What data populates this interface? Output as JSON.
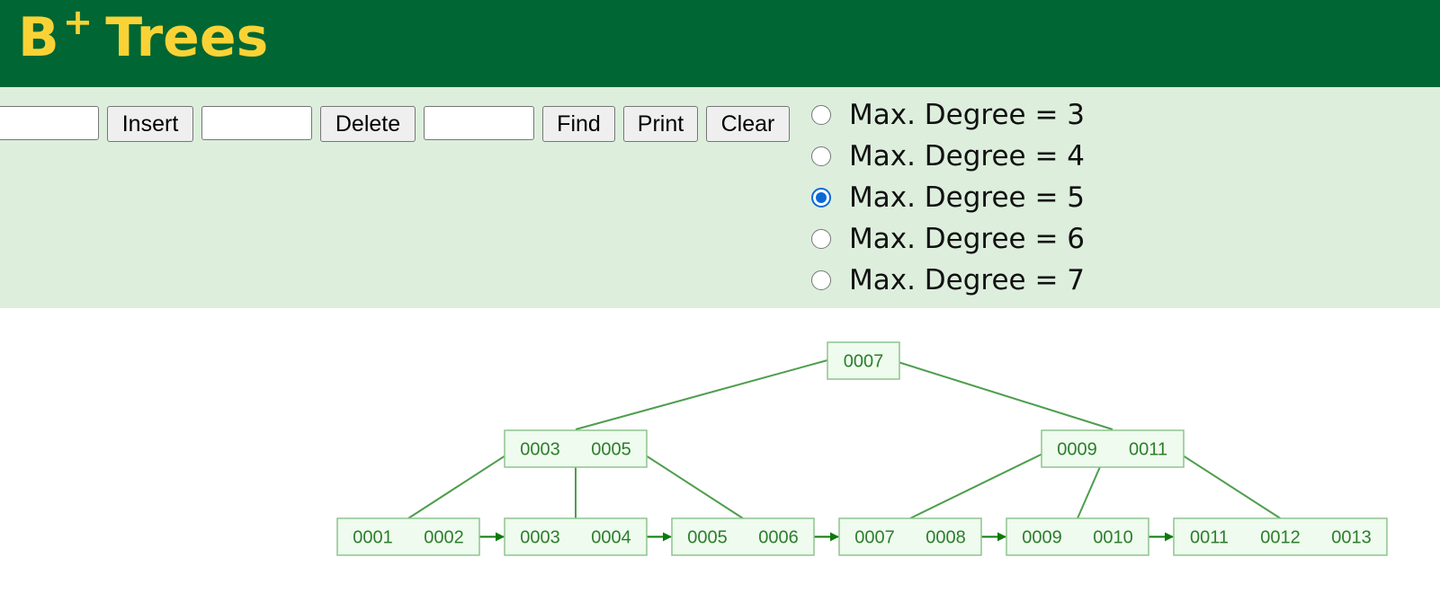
{
  "header": {
    "title_main": "B",
    "title_sup": "+",
    "title_rest": "Trees"
  },
  "controls": {
    "insert_value": "",
    "insert_label": "Insert",
    "delete_value": "",
    "delete_label": "Delete",
    "find_value": "",
    "find_label": "Find",
    "print_label": "Print",
    "clear_label": "Clear"
  },
  "degree_options": [
    {
      "label": "Max. Degree = 3",
      "checked": false
    },
    {
      "label": "Max. Degree = 4",
      "checked": false
    },
    {
      "label": "Max. Degree = 5",
      "checked": true
    },
    {
      "label": "Max. Degree = 6",
      "checked": false
    },
    {
      "label": "Max. Degree = 7",
      "checked": false
    }
  ],
  "tree": {
    "root": [
      "0007"
    ],
    "internal": [
      [
        "0003",
        "0005"
      ],
      [
        "0009",
        "0011"
      ]
    ],
    "leaves": [
      [
        "0001",
        "0002"
      ],
      [
        "0003",
        "0004"
      ],
      [
        "0005",
        "0006"
      ],
      [
        "0007",
        "0008"
      ],
      [
        "0009",
        "0010"
      ],
      [
        "0011",
        "0012",
        "0013"
      ]
    ],
    "colors": {
      "node_fill": "#eefbee",
      "node_stroke": "#8fc48f",
      "edge": "#4d9e4d",
      "arrow": "#0b7a0b",
      "text": "#2d7d2d"
    }
  }
}
